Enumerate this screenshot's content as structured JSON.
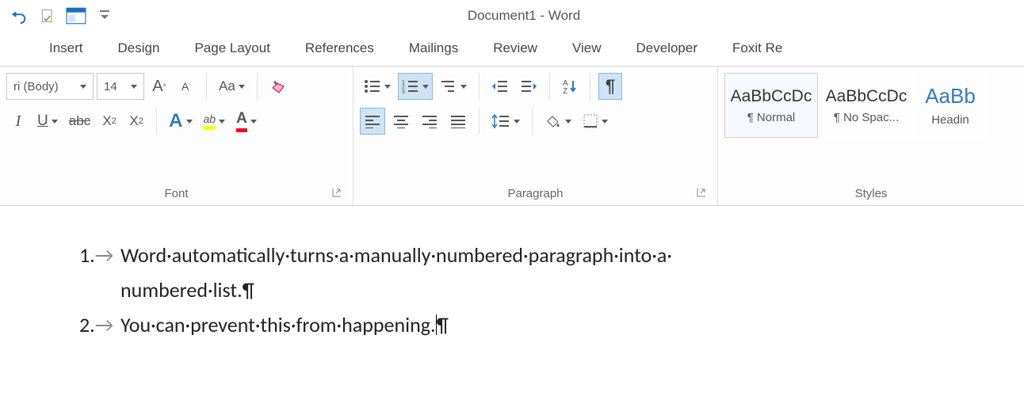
{
  "title": "Document1 - Word",
  "tabs": [
    "Insert",
    "Design",
    "Page Layout",
    "References",
    "Mailings",
    "Review",
    "View",
    "Developer",
    "Foxit Re"
  ],
  "font": {
    "name": "ri (Body)",
    "size": "14",
    "grow_label": "A",
    "shrink_label": "A",
    "case_label": "Aa",
    "group_label": "Font"
  },
  "para": {
    "group_label": "Paragraph"
  },
  "styles": {
    "group_label": "Styles",
    "items": [
      {
        "sample": "AaBbCcDc",
        "name": "¶ Normal"
      },
      {
        "sample": "AaBbCcDc",
        "name": "¶ No Spac..."
      },
      {
        "sample": "AaBb",
        "name": "Headin"
      }
    ]
  },
  "document": {
    "items": [
      {
        "num": "1.",
        "tab": "→",
        "text_line1": "Word·automatically·turns·a·manually·numbered·paragraph·into·a·",
        "text_line2": "numbered·list.¶"
      },
      {
        "num": "2.",
        "tab": "→",
        "text": "You·can·prevent·this·from·happening.",
        "pil": "¶"
      }
    ]
  }
}
